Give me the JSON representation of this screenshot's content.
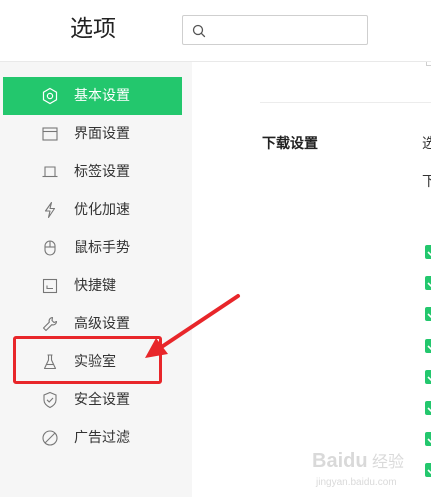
{
  "header": {
    "title": "选项",
    "search": {
      "value": "",
      "placeholder": ""
    }
  },
  "sidebar": {
    "items": [
      {
        "label": "基本设置",
        "icon": "gear-icon",
        "active": true
      },
      {
        "label": "界面设置",
        "icon": "window-icon",
        "active": false
      },
      {
        "label": "标签设置",
        "icon": "tab-icon",
        "active": false
      },
      {
        "label": "优化加速",
        "icon": "lightning-icon",
        "active": false
      },
      {
        "label": "鼠标手势",
        "icon": "mouse-icon",
        "active": false
      },
      {
        "label": "快捷键",
        "icon": "keyboard-icon",
        "active": false
      },
      {
        "label": "高级设置",
        "icon": "wrench-icon",
        "active": false
      },
      {
        "label": "实验室",
        "icon": "flask-icon",
        "active": false,
        "highlighted": true
      },
      {
        "label": "安全设置",
        "icon": "shield-icon",
        "active": false
      },
      {
        "label": "广告过滤",
        "icon": "block-icon",
        "active": false
      }
    ]
  },
  "main": {
    "section_title": "下载设置",
    "option_fragment_1": "选",
    "option_fragment_2": "下",
    "checked_count": 8
  },
  "colors": {
    "accent": "#23c76d",
    "annotation": "#e8262a",
    "sidebar_bg": "#f6f6f6"
  },
  "watermark": {
    "text": "Baidu 经验",
    "url_text": "jingyan.baidu.com"
  }
}
